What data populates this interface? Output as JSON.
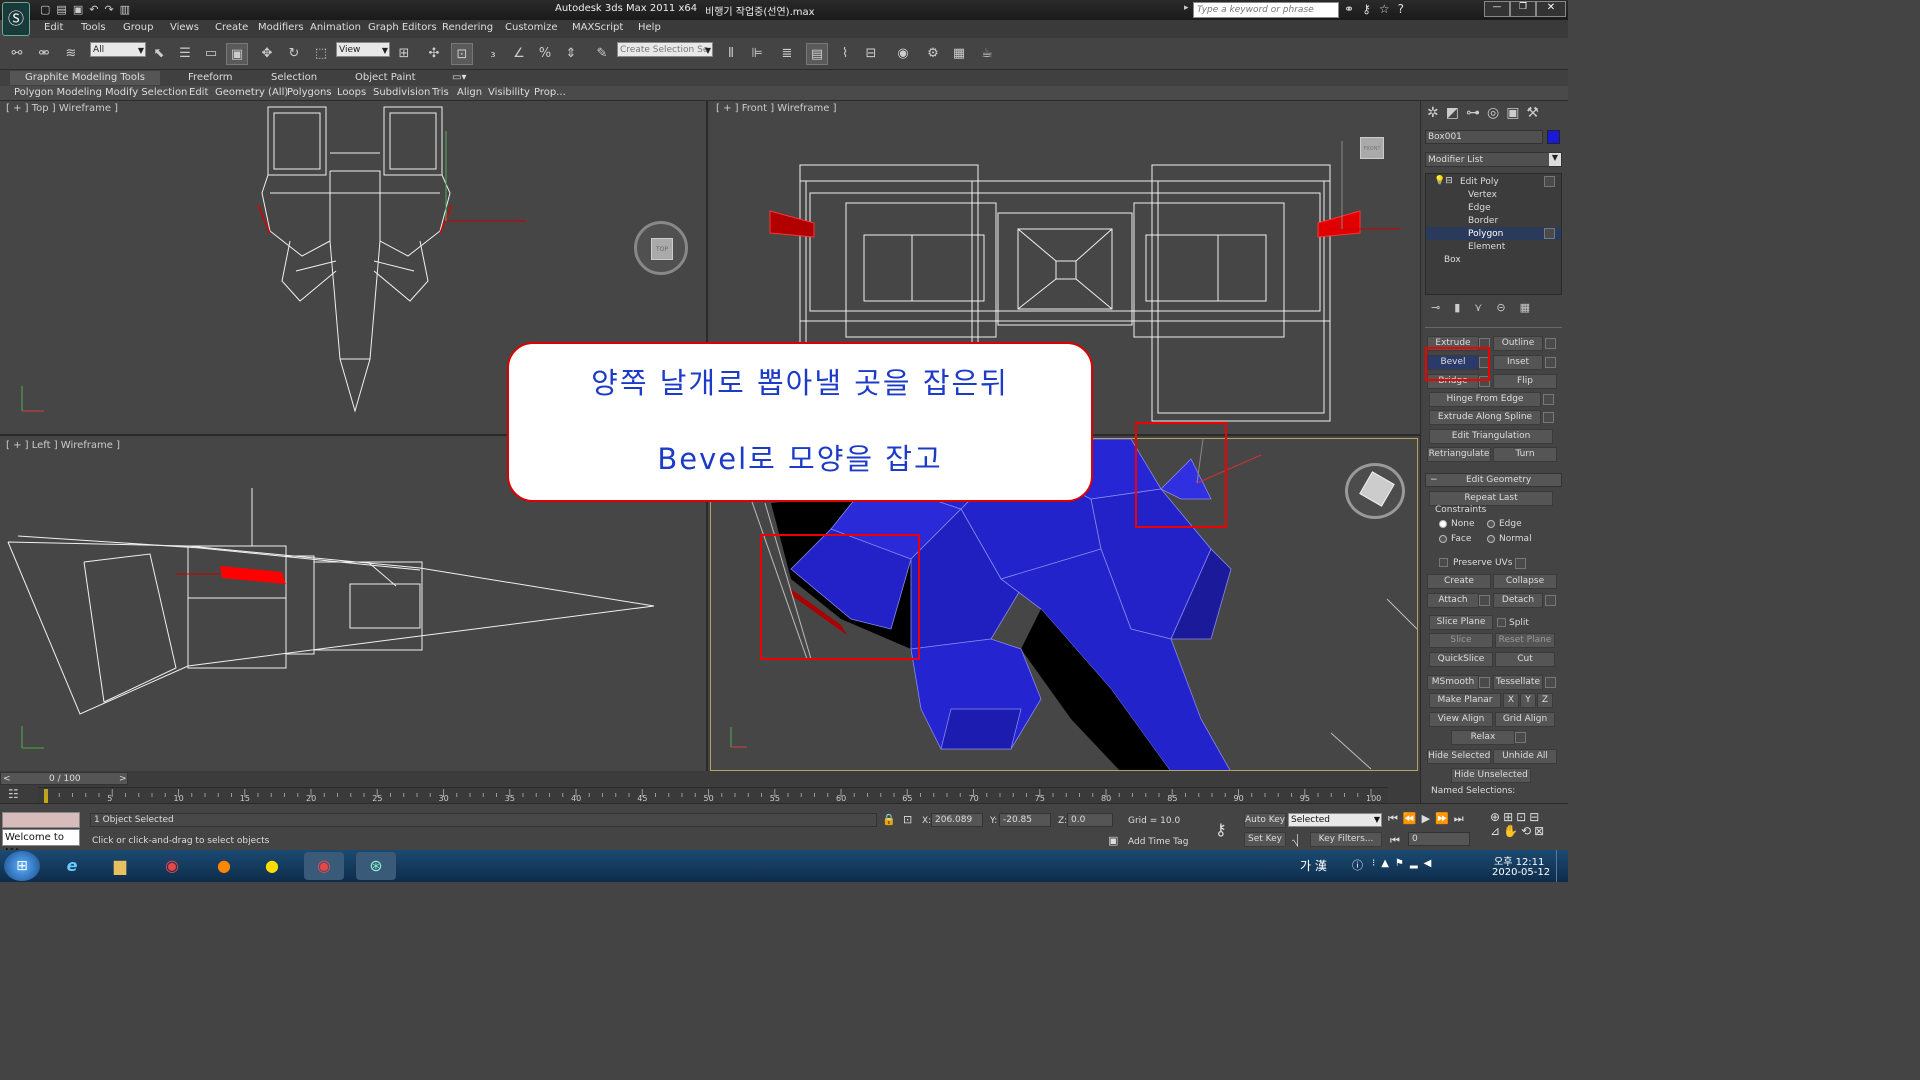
{
  "title_bar": {
    "app_title": "Autodesk 3ds Max  2011 x64",
    "file_name": "비행기 작업중(선연).max",
    "search_placeholder": "Type a keyword or phrase"
  },
  "menu": [
    "Edit",
    "Tools",
    "Group",
    "Views",
    "Create",
    "Modifiers",
    "Animation",
    "Graph Editors",
    "Rendering",
    "Customize",
    "MAXScript",
    "Help"
  ],
  "toolbar": {
    "selection_filter": "All",
    "reference_coord": "View",
    "named_selection_placeholder": "Create Selection Se"
  },
  "ribbon_tabs": [
    "Graphite Modeling Tools",
    "Freeform",
    "Selection",
    "Object Paint"
  ],
  "ribbon_subtabs": [
    "Polygon Modeling",
    "Modify Selection",
    "Edit",
    "Geometry (All)",
    "Polygons",
    "Loops",
    "Subdivision",
    "Tris",
    "Align",
    "Visibility",
    "Prop..."
  ],
  "viewports": {
    "top": "[ + ] Top ] Wireframe ]",
    "front": "[ + ] Front ] Wireframe ]",
    "left": "[ + ] Left ] Wireframe ]",
    "top_cube": "TOP",
    "front_cube": "FRONT"
  },
  "callout": {
    "line1": "양쪽 날개로 뽑아낼 곳을 잡은뒤",
    "line2": "Bevel로 모양을 잡고"
  },
  "command_panel": {
    "object_name": "Box001",
    "object_color": "#1a1ad6",
    "modifier_list": "Modifier List",
    "stack": [
      "Edit Poly",
      "Vertex",
      "Edge",
      "Border",
      "Polygon",
      "Element",
      "Box"
    ],
    "edit_polygons": {
      "extrude": "Extrude",
      "outline": "Outline",
      "bevel": "Bevel",
      "inset": "Inset",
      "bridge": "Bridge",
      "flip": "Flip",
      "hinge": "Hinge From Edge",
      "extrude_spline": "Extrude Along Spline",
      "edit_triangulation": "Edit Triangulation",
      "retriangulate": "Retriangulate",
      "turn": "Turn"
    },
    "edit_geometry": {
      "header": "Edit Geometry",
      "repeat_last": "Repeat Last",
      "constraints": "Constraints",
      "none": "None",
      "edge": "Edge",
      "face": "Face",
      "normal": "Normal",
      "preserve_uvs": "Preserve UVs",
      "create": "Create",
      "collapse": "Collapse",
      "attach": "Attach",
      "detach": "Detach",
      "slice_plane": "Slice Plane",
      "split": "Split",
      "slice": "Slice",
      "reset_plane": "Reset Plane",
      "quickslice": "QuickSlice",
      "cut": "Cut",
      "msmooth": "MSmooth",
      "tessellate": "Tessellate",
      "make_planar": "Make Planar",
      "x": "X",
      "y": "Y",
      "z": "Z",
      "view_align": "View Align",
      "grid_align": "Grid Align",
      "relax": "Relax",
      "hide_selected": "Hide Selected",
      "unhide_all": "Unhide All",
      "hide_unselected": "Hide Unselected",
      "named_selections": "Named Selections:"
    }
  },
  "timeline": {
    "frame_display": "0 / 100",
    "ticks": [
      "5",
      "10",
      "15",
      "20",
      "25",
      "30",
      "35",
      "40",
      "45",
      "50",
      "55",
      "60",
      "65",
      "70",
      "75",
      "80",
      "85",
      "90",
      "95",
      "100"
    ]
  },
  "status": {
    "selected": "1 Object Selected",
    "prompt": "Click or click-and-drag to select objects",
    "maxscript": "Welcome to MA",
    "x_label": "X:",
    "x": "206.089",
    "y_label": "Y:",
    "y": "-20.85",
    "z_label": "Z:",
    "z": "0.0",
    "grid": "Grid = 10.0",
    "auto_key": "Auto Key",
    "set_key": "Set Key",
    "key_mode": "Selected",
    "key_filters": "Key Filters...",
    "add_time_tag": "Add Time Tag",
    "frame": "0"
  },
  "taskbar": {
    "ime": "가 漢",
    "time": "오후 12:11",
    "date": "2020-05-12"
  }
}
